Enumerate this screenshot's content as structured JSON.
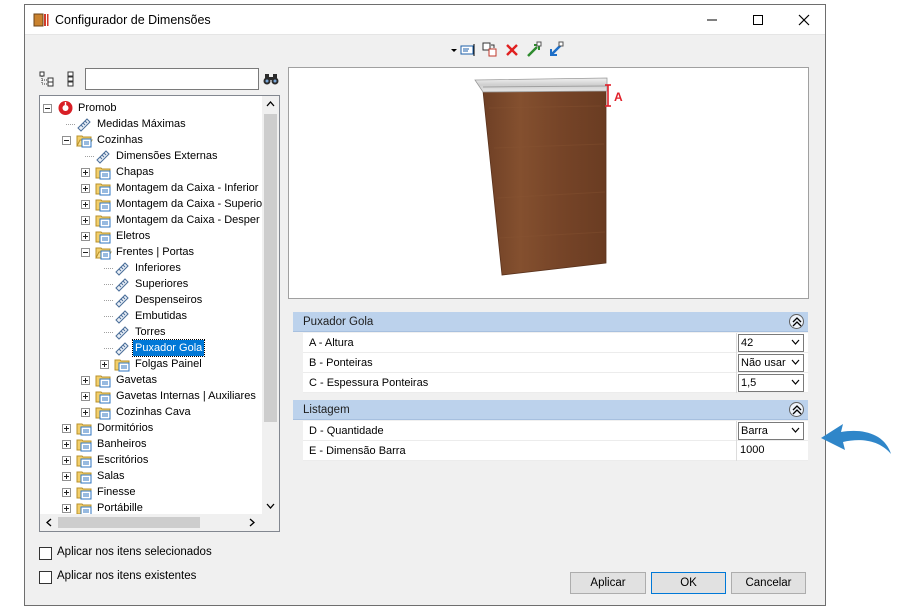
{
  "window": {
    "title": "Configurador de Dimensões",
    "icon": "app-dimension-icon"
  },
  "toolbar": {
    "icons": [
      "dropdown-arrow-icon",
      "edit-text-icon",
      "copy-icon",
      "delete-icon",
      "export-icon",
      "import-icon"
    ],
    "accent_delete": "#e02020"
  },
  "search": {
    "value": "",
    "placeholder": ""
  },
  "tree": {
    "items": [
      {
        "label": "Promob",
        "level": 0,
        "expander": "minus",
        "icon": "promob-logo-icon"
      },
      {
        "label": "Medidas Máximas",
        "level": 1,
        "expander": "none",
        "icon": "ruler-icon"
      },
      {
        "label": "Cozinhas",
        "level": 1,
        "expander": "minus",
        "icon": "folder-open-icon"
      },
      {
        "label": "Dimensões Externas",
        "level": 2,
        "expander": "none",
        "icon": "ruler-icon"
      },
      {
        "label": "Chapas",
        "level": 2,
        "expander": "plus",
        "icon": "folder-icon"
      },
      {
        "label": "Montagem da Caixa - Inferior",
        "level": 2,
        "expander": "plus",
        "icon": "folder-icon"
      },
      {
        "label": "Montagem da Caixa - Superio",
        "level": 2,
        "expander": "plus",
        "icon": "folder-icon"
      },
      {
        "label": "Montagem da Caixa - Desper",
        "level": 2,
        "expander": "plus",
        "icon": "folder-icon"
      },
      {
        "label": "Eletros",
        "level": 2,
        "expander": "plus",
        "icon": "folder-icon"
      },
      {
        "label": "Frentes | Portas",
        "level": 2,
        "expander": "minus",
        "icon": "folder-open-icon"
      },
      {
        "label": "Inferiores",
        "level": 3,
        "expander": "none",
        "icon": "ruler-icon"
      },
      {
        "label": "Superiores",
        "level": 3,
        "expander": "none",
        "icon": "ruler-icon"
      },
      {
        "label": "Despenseiros",
        "level": 3,
        "expander": "none",
        "icon": "ruler-icon"
      },
      {
        "label": "Embutidas",
        "level": 3,
        "expander": "none",
        "icon": "ruler-icon"
      },
      {
        "label": "Torres",
        "level": 3,
        "expander": "none",
        "icon": "ruler-icon"
      },
      {
        "label": "Puxador Gola",
        "level": 3,
        "expander": "none",
        "icon": "ruler-icon",
        "selected": true
      },
      {
        "label": "Folgas Painel",
        "level": 3,
        "expander": "plus",
        "icon": "folder-icon"
      },
      {
        "label": "Gavetas",
        "level": 2,
        "expander": "plus",
        "icon": "folder-icon"
      },
      {
        "label": "Gavetas Internas | Auxiliares",
        "level": 2,
        "expander": "plus",
        "icon": "folder-icon"
      },
      {
        "label": "Cozinhas Cava",
        "level": 2,
        "expander": "plus",
        "icon": "folder-icon"
      },
      {
        "label": "Dormitórios",
        "level": 1,
        "expander": "plus",
        "icon": "folder-icon"
      },
      {
        "label": "Banheiros",
        "level": 1,
        "expander": "plus",
        "icon": "folder-icon"
      },
      {
        "label": "Escritórios",
        "level": 1,
        "expander": "plus",
        "icon": "folder-icon"
      },
      {
        "label": "Salas",
        "level": 1,
        "expander": "plus",
        "icon": "folder-icon"
      },
      {
        "label": "Finesse",
        "level": 1,
        "expander": "plus",
        "icon": "folder-icon"
      },
      {
        "label": "Portábille",
        "level": 1,
        "expander": "plus",
        "icon": "folder-icon"
      }
    ]
  },
  "preview": {
    "dimension_label": "A",
    "panel_color": "#7b4a2e",
    "handle_color": "#d8d8d8",
    "accent_color": "#e0202a"
  },
  "properties": {
    "groups": [
      {
        "title": "Puxador Gola",
        "rows": [
          {
            "label": "A - Altura",
            "value": "42",
            "type": "combo"
          },
          {
            "label": "B - Ponteiras",
            "value": "Não usar",
            "type": "combo"
          },
          {
            "label": "C - Espessura Ponteiras",
            "value": "1,5",
            "type": "combo"
          }
        ]
      },
      {
        "title": "Listagem",
        "rows": [
          {
            "label": "D - Quantidade",
            "value": "Barra",
            "type": "combo"
          },
          {
            "label": "E - Dimensão Barra",
            "value": "1000",
            "type": "text"
          }
        ]
      }
    ],
    "header_color": "#bcd2ec"
  },
  "options": {
    "apply_selected": "Aplicar nos itens selecionados",
    "apply_existing": "Aplicar nos itens existentes"
  },
  "buttons": {
    "apply": "Aplicar",
    "ok": "OK",
    "cancel": "Cancelar"
  },
  "annotation": {
    "arrow_color": "#2f86c9",
    "icon": "curved-arrow-icon"
  }
}
